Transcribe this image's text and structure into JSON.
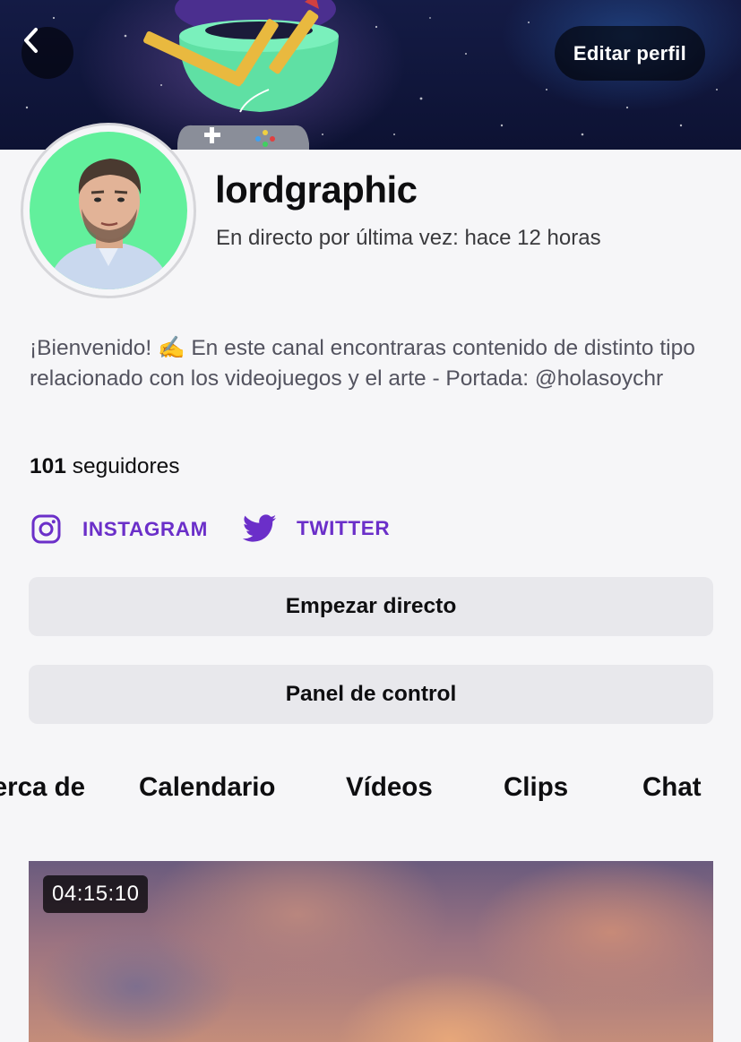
{
  "header": {
    "edit_profile_label": "Editar perfil"
  },
  "profile": {
    "username": "lordgraphic",
    "last_live": "En directo por última vez: hace 12 horas",
    "bio": "¡Bienvenido! ✍️ En este canal encontraras contenido de distinto tipo relacionado con los videojuegos y el arte - Portada: @holasoychr",
    "followers_count": "101",
    "followers_label": "seguidores"
  },
  "social": {
    "instagram_label": "INSTAGRAM",
    "twitter_label": "TWITTER"
  },
  "actions": {
    "start_stream_label": "Empezar directo",
    "control_panel_label": "Panel de control"
  },
  "tabs": [
    {
      "label": "Acerca de"
    },
    {
      "label": "Calendario"
    },
    {
      "label": "Vídeos"
    },
    {
      "label": "Clips"
    },
    {
      "label": "Chat"
    }
  ],
  "video": {
    "duration": "04:15:10"
  },
  "colors": {
    "accent": "#6b2fc9",
    "avatar_bg": "#62f09c",
    "page_bg": "#f6f6f8",
    "button_bg": "#e8e8ec"
  }
}
